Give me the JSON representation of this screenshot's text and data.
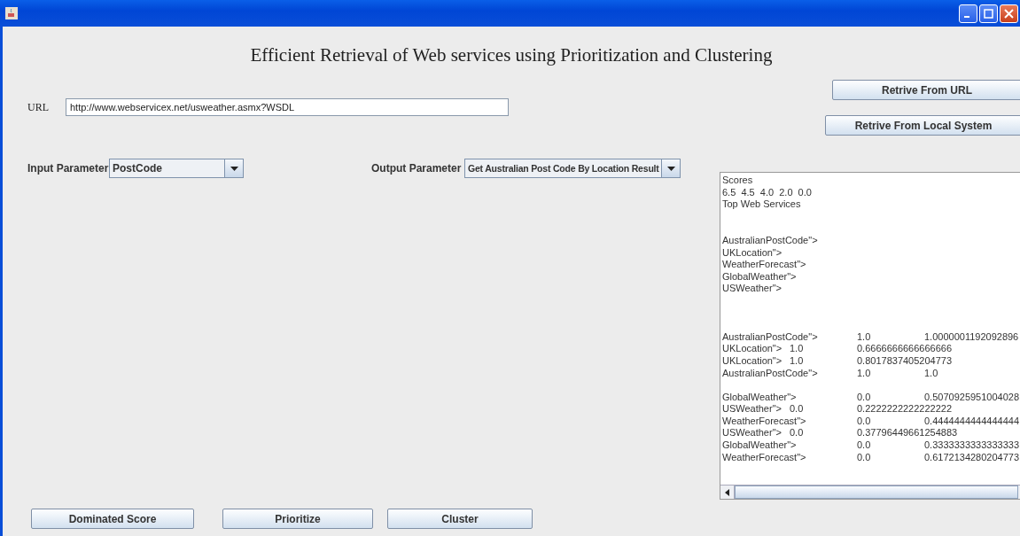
{
  "heading": "Efficient Retrieval of Web services using Prioritization and Clustering",
  "url": {
    "label": "URL",
    "value": "http://www.webservicex.net/usweather.asmx?WSDL"
  },
  "retrieve_buttons": [
    "Retrive From URL",
    "Retrive From Local System"
  ],
  "input_parameter": {
    "label": "Input Parameter",
    "value": "PostCode"
  },
  "output_parameter": {
    "label": "Output Parameter",
    "value": "Get Australian Post Code By Location Result"
  },
  "output_blocks": [
    [
      "Scores",
      "6.5  4.5  4.0  2.0  0.0",
      "Top Web Services"
    ],
    [
      "AustralianPostCode\">",
      "UKLocation\">",
      "WeatherForecast\">",
      "GlobalWeather\">",
      "USWeather\">"
    ],
    [
      "AustralianPostCode\">\t1.0\t1.0000001192092896",
      "UKLocation\">\t1.0\t0.6666666666666666",
      "UKLocation\">\t1.0\t0.8017837405204773",
      "AustralianPostCode\">\t1.0\t1.0"
    ],
    [
      "GlobalWeather\">\t0.0\t0.5070925951004028",
      "USWeather\">\t0.0\t0.2222222222222222",
      "WeatherForecast\">\t0.0\t0.4444444444444444",
      "USWeather\">\t0.0\t0.37796449661254883",
      "GlobalWeather\">\t0.0\t0.3333333333333333",
      "WeatherForecast\">\t0.0\t0.6172134280204773"
    ]
  ],
  "action_buttons": [
    "Dominated Score",
    "Prioritize",
    "Cluster"
  ]
}
